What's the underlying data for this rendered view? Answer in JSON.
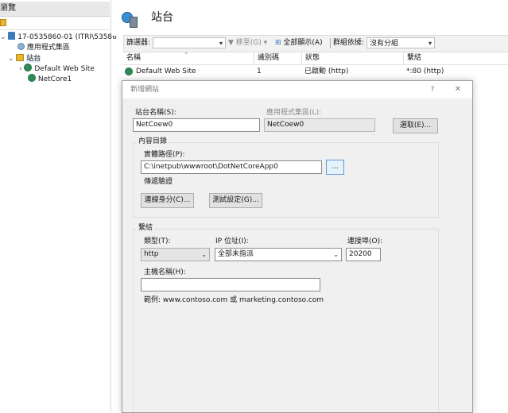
{
  "left": {
    "header": "瀏覽",
    "tree": {
      "server": "17-0535860-01 (ITRI\\53586",
      "app_pools": "應用程式集區",
      "sites": "站台",
      "site1": "Default Web Site",
      "site2": "NetCore1"
    }
  },
  "page": {
    "title": "站台"
  },
  "filterbar": {
    "filter_label": "篩選器:",
    "go_label": "移至(G)",
    "show_all_label": "全部顯示(A)",
    "group_label": "群組依據:",
    "group_value": "沒有分組"
  },
  "grid": {
    "columns": [
      "名稱",
      "識別碼",
      "狀態",
      "繫結"
    ],
    "rows": [
      {
        "name": "Default Web Site",
        "id": "1",
        "status": "已啟動 (http)",
        "binding": "*:80 (http)"
      }
    ]
  },
  "dialog": {
    "title": "新增網站",
    "help": "?",
    "close": "✕",
    "site_name_label": "站台名稱(S):",
    "site_name_value": "NetCoew0",
    "app_pool_label": "應用程式集區(L):",
    "app_pool_value": "NetCoew0",
    "select_button": "選取(E)...",
    "content_dir_label": "內容目錄",
    "physical_path_label": "實體路徑(P):",
    "physical_path_value": "C:\\inetpub\\wwwroot\\DotNetCoreApp0",
    "browse_button": "...",
    "passthrough_label": "傳遞驗證",
    "connect_as_button": "連線身分(C)...",
    "test_settings_button": "測試設定(G)...",
    "binding_label": "繫結",
    "type_label": "類型(T):",
    "type_value": "http",
    "ip_label": "IP 位址(I):",
    "ip_value": "全部未指派",
    "port_label": "連接埠(O):",
    "port_value": "20200",
    "hostname_label": "主機名稱(H):",
    "hostname_value": "",
    "example_text": "範例: www.contoso.com 或 marketing.contoso.com"
  }
}
